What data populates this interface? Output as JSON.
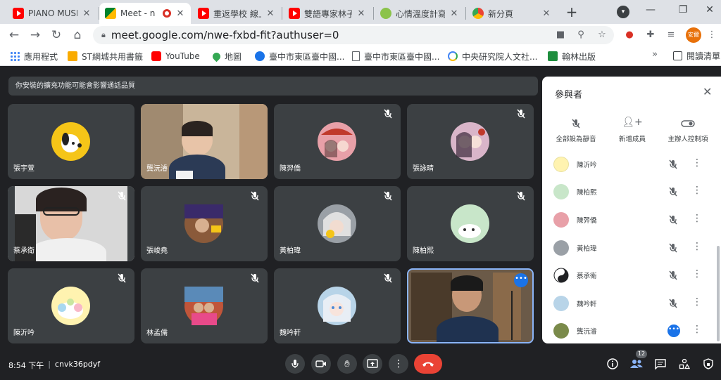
{
  "browser": {
    "tabs": [
      {
        "title": "PIANO MUSI",
        "icon": "youtube-icon"
      },
      {
        "title": "Meet - n",
        "icon": "google-meet-icon",
        "active": true
      },
      {
        "title": "重返學校 線上",
        "icon": "youtube-icon"
      },
      {
        "title": "雙語專家林子",
        "icon": "youtube-icon"
      },
      {
        "title": "心情溫度計寫",
        "icon": "leaf-icon"
      },
      {
        "title": "新分頁",
        "icon": "chrome-icon"
      }
    ],
    "url": "meet.google.com/nwe-fxbd-fit?authuser=0",
    "profile_label": "安爾",
    "bookmarks": [
      {
        "label": "應用程式",
        "icon": "apps-grid-icon"
      },
      {
        "label": "ST網城共用書籤",
        "icon": "folder-icon"
      },
      {
        "label": "YouTube",
        "icon": "youtube-icon"
      },
      {
        "label": "地圖",
        "icon": "maps-pin-icon"
      },
      {
        "label": "臺中市東區臺中國...",
        "icon": "school-icon"
      },
      {
        "label": "臺中市東區臺中國...",
        "icon": "document-icon"
      },
      {
        "label": "中央研究院人文社...",
        "icon": "google-icon"
      },
      {
        "label": "翰林出版",
        "icon": "hanlin-icon"
      }
    ],
    "bookmarks_more": "»",
    "reading_list": "閱讀清單"
  },
  "meet": {
    "banner_text": "你安裝的擴充功能可能會影響通話品質",
    "tiles": [
      {
        "name": "張宇萱",
        "muted": false,
        "kind": "avatar",
        "color": "#f5c518"
      },
      {
        "name": "龔沅濬",
        "muted": false,
        "kind": "video",
        "color": "#c9b59a"
      },
      {
        "name": "陳羿僑",
        "muted": true,
        "kind": "avatar",
        "color": "#e8a0a8"
      },
      {
        "name": "張詠晴",
        "muted": true,
        "kind": "avatar",
        "color": "#d9b5c9"
      },
      {
        "name": "蔡承衛",
        "muted": true,
        "kind": "video",
        "color": "#d8d8d8"
      },
      {
        "name": "張峻堯",
        "muted": true,
        "kind": "avatar",
        "color": "#8a5a3a"
      },
      {
        "name": "黃柏瑋",
        "muted": true,
        "kind": "avatar",
        "color": "#9aa0a6"
      },
      {
        "name": "陳柏熙",
        "muted": true,
        "kind": "avatar",
        "color": "#c8e6c9"
      },
      {
        "name": "陳沂吟",
        "muted": true,
        "kind": "avatar",
        "color": "#fff3b0"
      },
      {
        "name": "林孟儒",
        "muted": true,
        "kind": "avatar",
        "color": "#c0553a"
      },
      {
        "name": "魏吟軒",
        "muted": true,
        "kind": "avatar",
        "color": "#b8d4e8"
      },
      {
        "name": "",
        "muted": false,
        "kind": "self-video",
        "color": "#6b5a48"
      }
    ],
    "panel": {
      "title": "參與者",
      "actions": [
        {
          "label": "全部設為靜音",
          "icon": "mic-off-icon"
        },
        {
          "label": "新增成員",
          "icon": "person-add-icon"
        },
        {
          "label": "主辦人控制項",
          "icon": "toggle-icon"
        }
      ],
      "participants": [
        {
          "name": "陳沂吟",
          "muted": true,
          "color": "#fff3b0"
        },
        {
          "name": "陳柏熙",
          "muted": true,
          "color": "#c8e6c9"
        },
        {
          "name": "陳羿僑",
          "muted": true,
          "color": "#e8a0a8"
        },
        {
          "name": "黃柏瑋",
          "muted": true,
          "color": "#9aa0a6"
        },
        {
          "name": "蔡承衛",
          "muted": true,
          "color": "#202124"
        },
        {
          "name": "魏吟軒",
          "muted": true,
          "color": "#b8d4e8"
        },
        {
          "name": "龔沅濬",
          "muted": false,
          "speaking": true,
          "color": "#7a8a4a"
        }
      ]
    },
    "bottom": {
      "time": "8:54 下午",
      "separator": "|",
      "meeting_code": "cnvk36pdyf",
      "people_count": "12"
    }
  }
}
